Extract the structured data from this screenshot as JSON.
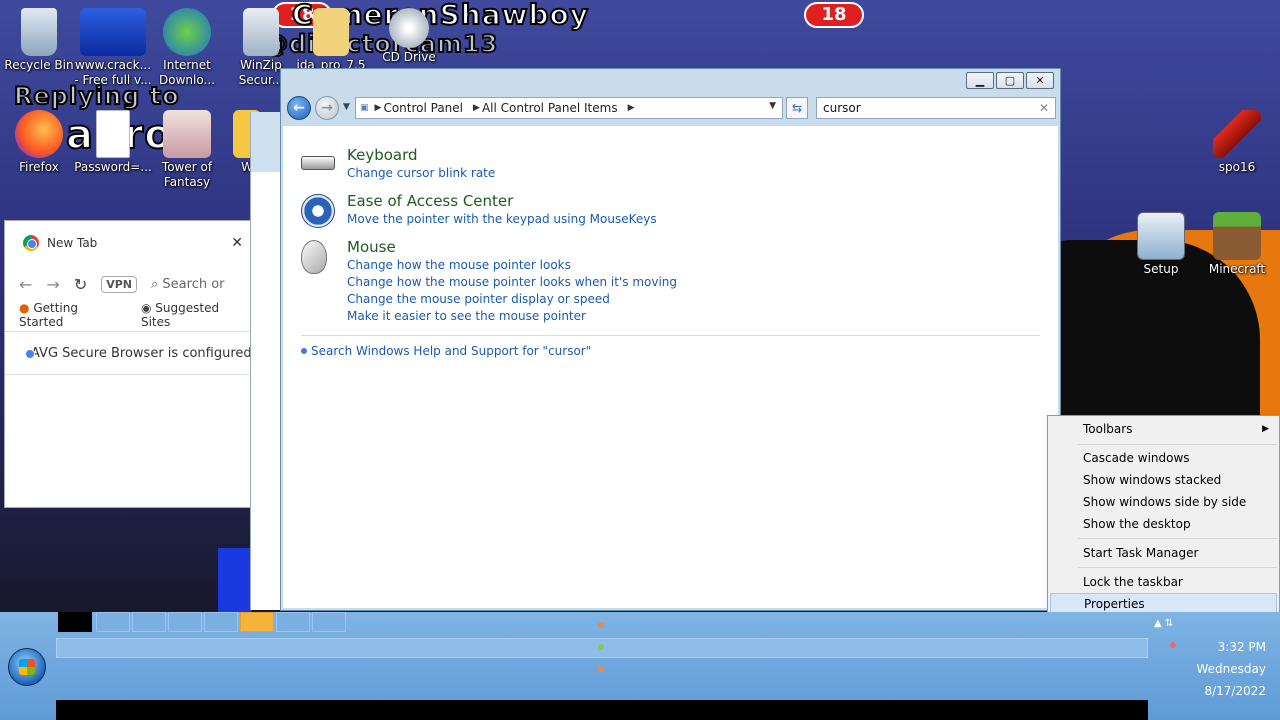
{
  "desktop": {
    "overlay": {
      "streamer": "CameronShawboy",
      "badge": "18",
      "handle": "@directorcam13",
      "replying": "Replying to",
      "nick": "ahro"
    },
    "icons_left": [
      {
        "name": "recycle-bin",
        "label": "Recycle Bin"
      },
      {
        "name": "crack-shortcut",
        "label": "www.crack... - Free full v..."
      },
      {
        "name": "internet-download-manager",
        "label": "Internet Downlo..."
      },
      {
        "name": "winzip",
        "label": "WinZip Secur..."
      },
      {
        "name": "ida-pro",
        "label": "ida_pro_7.5"
      },
      {
        "name": "cd-drive",
        "label": "CD Drive"
      },
      {
        "name": "firefox",
        "label": "Firefox"
      },
      {
        "name": "password-file",
        "label": "Password=..."
      },
      {
        "name": "tower-of-fantasy",
        "label": "Tower of Fantasy"
      },
      {
        "name": "w-shortcut",
        "label": "W"
      }
    ],
    "icons_right": [
      {
        "name": "spo16",
        "label": "spo16"
      },
      {
        "name": "setup",
        "label": "Setup"
      },
      {
        "name": "minecraft",
        "label": "Minecraft"
      }
    ]
  },
  "chrome": {
    "tab_title": "New Tab",
    "search_placeholder": "Search or",
    "vpn_label": "VPN",
    "bookmarks": [
      "Getting Started",
      "Suggested Sites"
    ],
    "infobar": "AVG Secure Browser is configured"
  },
  "control_panel": {
    "breadcrumbs": [
      "Control Panel",
      "All Control Panel Items"
    ],
    "search_value": "cursor",
    "results": [
      {
        "title": "Keyboard",
        "links": [
          "Change cursor blink rate"
        ],
        "icon": "keyboard-icon"
      },
      {
        "title": "Ease of Access Center",
        "links": [
          "Move the pointer with the keypad using MouseKeys"
        ],
        "icon": "ease-of-access-icon"
      },
      {
        "title": "Mouse",
        "links": [
          "Change how the mouse pointer looks",
          "Change how the mouse pointer looks when it's moving",
          "Change the mouse pointer display or speed",
          "Make it easier to see the mouse pointer"
        ],
        "icon": "mouse-icon"
      }
    ],
    "help_link": "Search Windows Help and Support for \"cursor\""
  },
  "context_menu": {
    "items": [
      "Toolbars",
      "Cascade windows",
      "Show windows stacked",
      "Show windows side by side",
      "Show the desktop",
      "Start Task Manager",
      "Lock the taskbar",
      "Properties"
    ],
    "highlighted": "Properties"
  },
  "taskbar": {
    "time": "3:32 PM",
    "day": "Wednesday",
    "date": "8/17/2022"
  }
}
